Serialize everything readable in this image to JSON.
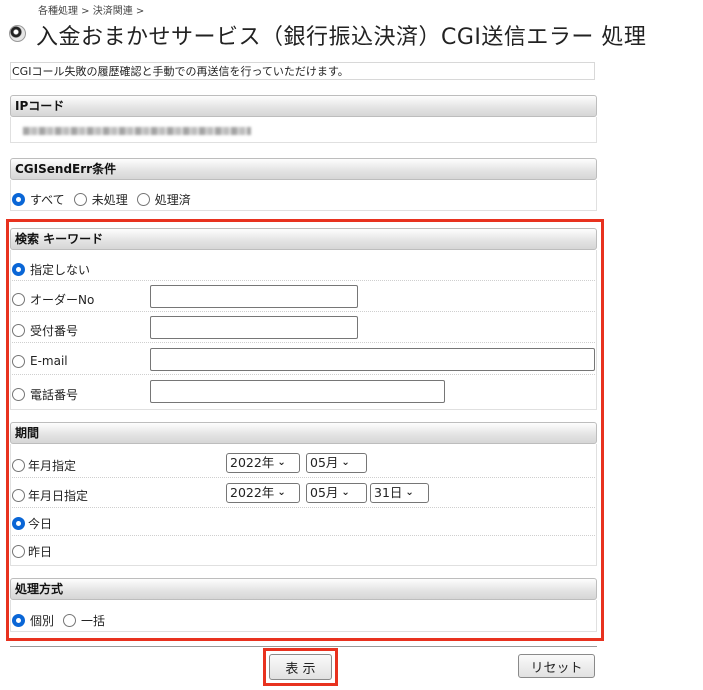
{
  "breadcrumb": "各種処理 > 決済関連 >",
  "page_title": "入金おまかせサービス（銀行振込決済）CGI送信エラー 処理",
  "description": "CGIコール失敗の履歴確認と手動での再送信を行っていただけます。",
  "ip_section": {
    "heading": "IPコード"
  },
  "cgi_section": {
    "heading": "CGISendErr条件",
    "options": [
      "すべて",
      "未処理",
      "処理済"
    ],
    "selected": "すべて"
  },
  "keyword_section": {
    "heading": "検索 キーワード",
    "options": [
      "指定しない",
      "オーダーNo",
      "受付番号",
      "E-mail",
      "電話番号"
    ],
    "selected": "指定しない"
  },
  "period_section": {
    "heading": "期間",
    "options": [
      "年月指定",
      "年月日指定",
      "今日",
      "昨日"
    ],
    "selected": "今日",
    "ym_year": "2022年",
    "ym_month": "05月",
    "ymd_year": "2022年",
    "ymd_month": "05月",
    "ymd_day": "31日"
  },
  "method_section": {
    "heading": "処理方式",
    "options": [
      "個別",
      "一括"
    ],
    "selected": "個別"
  },
  "buttons": {
    "show": "表 示",
    "reset": "リセット"
  },
  "colors": {
    "highlight": "#e8321f",
    "radio_checked": "#0a66d6"
  }
}
